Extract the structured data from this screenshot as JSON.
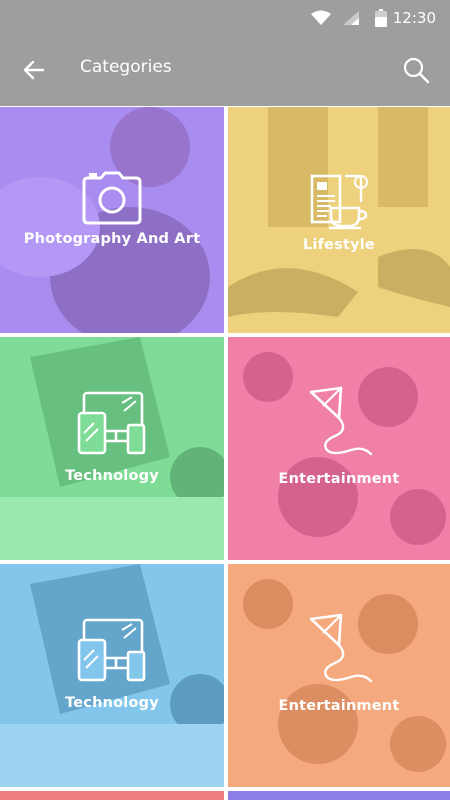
{
  "status_bar": {
    "time": "12:30"
  },
  "toolbar": {
    "title": "Categories",
    "back_icon": "arrow-left-icon",
    "search_icon": "search-icon"
  },
  "categories": [
    {
      "label": "Photography And Art",
      "icon": "camera-icon",
      "color": "#a98cf0"
    },
    {
      "label": "Lifestyle",
      "icon": "newspaper-coffee-icon",
      "color": "#eed17c"
    },
    {
      "label": "Technology",
      "icon": "devices-icon",
      "color": "#7fdc96"
    },
    {
      "label": "Entertainment",
      "icon": "kite-icon",
      "color": "#f080a8"
    },
    {
      "label": "Technology",
      "icon": "devices-icon",
      "color": "#82c6ec"
    },
    {
      "label": "Entertainment",
      "icon": "kite-icon",
      "color": "#f5a97e"
    }
  ],
  "partial_tiles": [
    {
      "color": "#ee7c80"
    },
    {
      "color": "#8c7fe8"
    }
  ],
  "colors": {
    "appbar": "#9e9e9e",
    "divider": "#ffffff"
  }
}
